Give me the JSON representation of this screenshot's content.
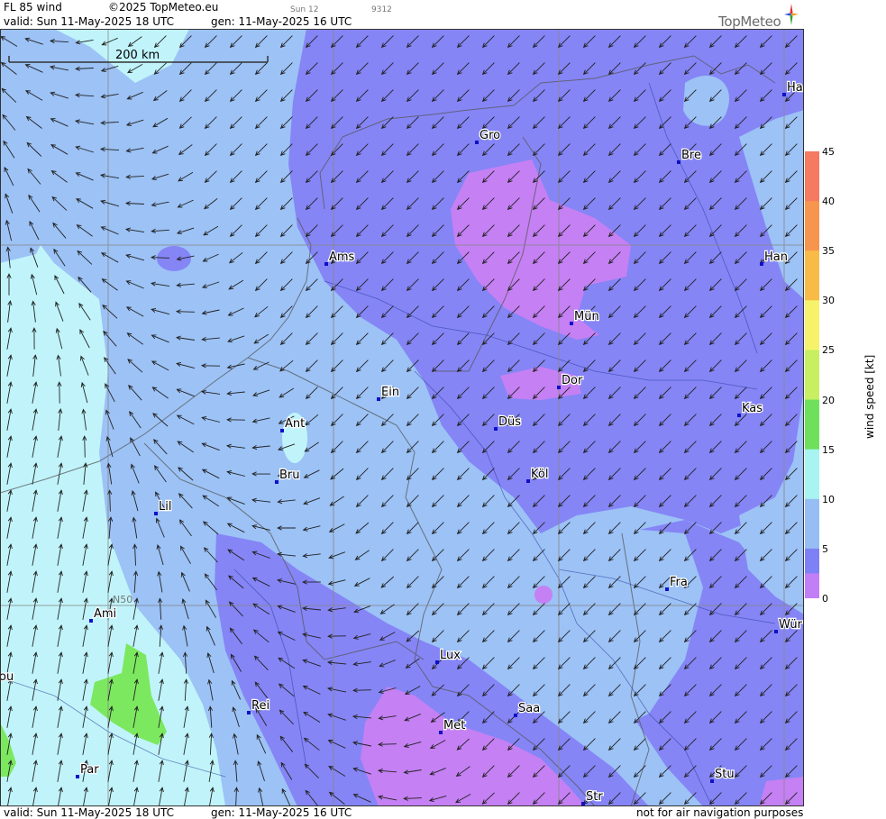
{
  "header": {
    "product": "FL 85 wind",
    "copyright": "©2025 TopMeteo.eu",
    "run_code": "Sun 12",
    "run_num": "9312",
    "valid": "valid:  Sun  11-May-2025  18 UTC",
    "generated": "gen: 11-May-2025 16 UTC",
    "logo_text": "TopMeteo"
  },
  "footer": {
    "valid": "valid:  Sun  11-May-2025  18 UTC",
    "generated": "gen: 11-May-2025 16 UTC",
    "disclaimer": "not for air navigation purposes"
  },
  "scale_bar": {
    "label": "200 km"
  },
  "graticule": {
    "lat_label": "N50"
  },
  "cities": [
    {
      "name": "Gro"
    },
    {
      "name": "Bre"
    },
    {
      "name": "Ha"
    },
    {
      "name": "Ams"
    },
    {
      "name": "Han"
    },
    {
      "name": "Mün"
    },
    {
      "name": "Dor"
    },
    {
      "name": "Ein"
    },
    {
      "name": "Kas"
    },
    {
      "name": "Ant"
    },
    {
      "name": "Düs"
    },
    {
      "name": "Köl"
    },
    {
      "name": "Bru"
    },
    {
      "name": "Lil"
    },
    {
      "name": "Fra"
    },
    {
      "name": "Ami"
    },
    {
      "name": "Wür"
    },
    {
      "name": "Lux"
    },
    {
      "name": "ou"
    },
    {
      "name": "Rei"
    },
    {
      "name": "Saa"
    },
    {
      "name": "Met"
    },
    {
      "name": "Stu"
    },
    {
      "name": "Par"
    },
    {
      "name": "Str"
    }
  ],
  "colorbar": {
    "title": "wind  speed  [kt]",
    "ticks": [
      "45",
      "40",
      "35",
      "30",
      "25",
      "20",
      "15",
      "10",
      "5",
      "0"
    ],
    "colors": [
      "#f47a60",
      "#f6954e",
      "#f8bb48",
      "#f6f36a",
      "#c8ef62",
      "#6fe05c",
      "#a8f4f0",
      "#b7e6f6",
      "#96bdf4",
      "#7e80f6",
      "#c27ef6"
    ]
  },
  "palette": {
    "cyan": "#c0f4fa",
    "light_blue": "#9cc2f6",
    "blue_purple": "#8585f6",
    "violet": "#c580f4",
    "green": "#7ce860",
    "city_marker": "#1010c8"
  }
}
